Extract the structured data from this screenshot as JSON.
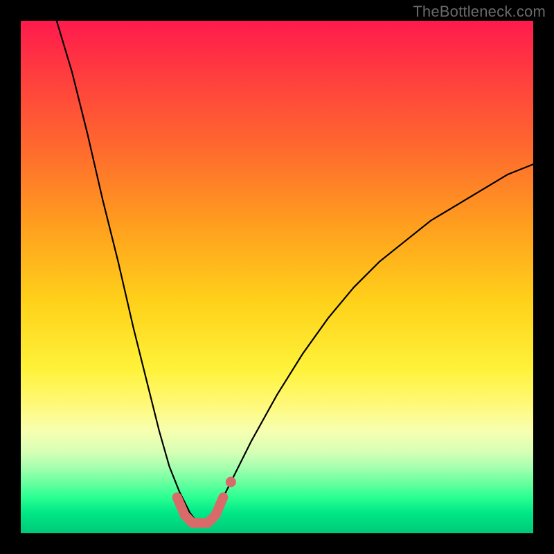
{
  "watermark": "TheBottleneck.com",
  "chart_data": {
    "type": "line",
    "title": "",
    "xlabel": "",
    "ylabel": "",
    "xlim": [
      0,
      100
    ],
    "ylim": [
      0,
      100
    ],
    "background": {
      "type": "vertical-gradient",
      "meaning": "bottleneck-heatmap",
      "stops": [
        {
          "pos": 0.0,
          "color": "#ff1a4d"
        },
        {
          "pos": 0.25,
          "color": "#ff6a2e"
        },
        {
          "pos": 0.55,
          "color": "#ffd21a"
        },
        {
          "pos": 0.8,
          "color": "#f7ffb0"
        },
        {
          "pos": 0.93,
          "color": "#2aff92"
        },
        {
          "pos": 1.0,
          "color": "#00c878"
        }
      ]
    },
    "series": [
      {
        "name": "bottleneck-curve",
        "color": "#000000",
        "x": [
          7,
          10,
          13,
          16,
          19,
          22,
          25,
          27,
          29,
          31,
          33,
          34.5,
          36,
          38,
          40,
          45,
          50,
          55,
          60,
          65,
          70,
          75,
          80,
          85,
          90,
          95,
          100
        ],
        "y": [
          100,
          90,
          78,
          65,
          53,
          40,
          28,
          20,
          13,
          8,
          4,
          2,
          2,
          4,
          8,
          18,
          27,
          35,
          42,
          48,
          53,
          57,
          61,
          64,
          67,
          70,
          72
        ]
      }
    ],
    "highlight": {
      "name": "optimal-range",
      "color": "#d96a6a",
      "x": [
        30.5,
        32,
        33.5,
        35,
        36.5,
        38,
        39.5
      ],
      "y": [
        7,
        3.5,
        2,
        2,
        2,
        3.5,
        7
      ],
      "end_dot": {
        "x": 41,
        "y": 10
      }
    }
  }
}
